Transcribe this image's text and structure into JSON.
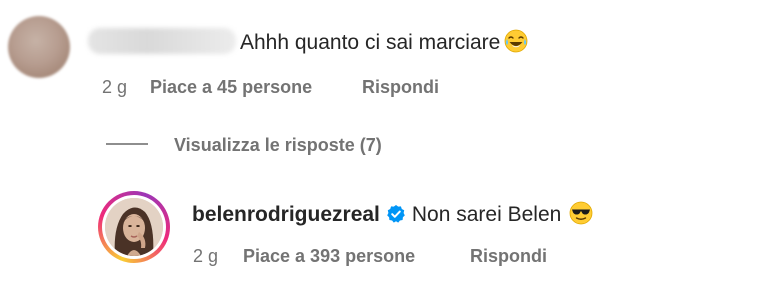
{
  "comment": {
    "text": "Ahhh quanto ci sai marciare",
    "emoji": "laughing-tears",
    "time": "2 g",
    "likes": "Piace a 45 persone",
    "reply": "Rispondi"
  },
  "replies_toggle": {
    "label": "Visualizza le risposte (7)"
  },
  "reply": {
    "username": "belenrodriguezreal",
    "text": "Non sarei Belen",
    "emoji": "sunglasses",
    "time": "2 g",
    "likes": "Piace a 393 persone",
    "reply": "Rispondi"
  },
  "colors": {
    "text": "#262626",
    "meta": "#737373",
    "verified": "#0095f6",
    "emoji": "#ffcc33"
  }
}
